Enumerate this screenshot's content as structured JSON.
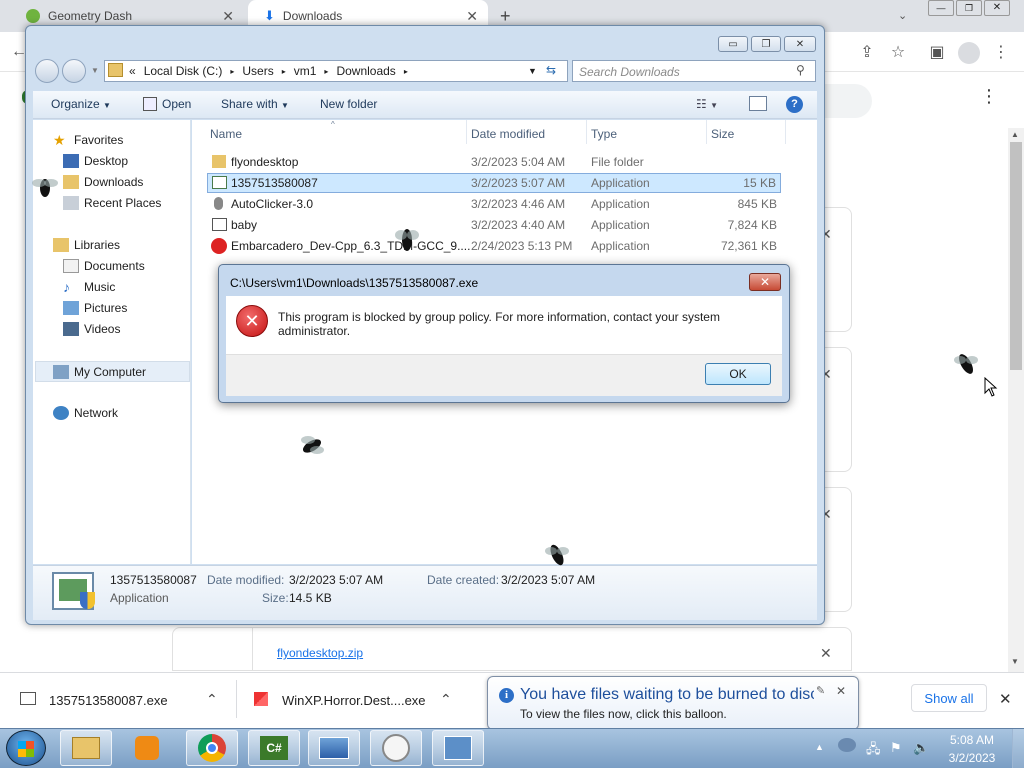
{
  "chrome": {
    "tabs": [
      {
        "label": "Geometry Dash"
      },
      {
        "label": "Downloads"
      }
    ],
    "new_tab": "+",
    "download_card": {
      "filename": "flyondesktop.zip"
    },
    "shelf": {
      "items": [
        {
          "filename": "1357513580087.exe"
        },
        {
          "filename": "WinXP.Horror.Dest....exe"
        }
      ],
      "show_all": "Show all"
    }
  },
  "explorer": {
    "breadcrumb": [
      "Local Disk (C:)",
      "Users",
      "vm1",
      "Downloads"
    ],
    "breadcrumb_prefix": "«",
    "search_placeholder": "Search Downloads",
    "toolbar": {
      "organize": "Organize",
      "open": "Open",
      "share_with": "Share with",
      "new_folder": "New folder"
    },
    "nav": {
      "favorites": "Favorites",
      "favorites_items": [
        "Desktop",
        "Downloads",
        "Recent Places"
      ],
      "libraries": "Libraries",
      "libraries_items": [
        "Documents",
        "Music",
        "Pictures",
        "Videos"
      ],
      "my_computer": "My Computer",
      "network": "Network"
    },
    "columns": [
      "Name",
      "Date modified",
      "Type",
      "Size"
    ],
    "files": [
      {
        "name": "flyondesktop",
        "date": "3/2/2023 5:04 AM",
        "type": "File folder",
        "size": ""
      },
      {
        "name": "1357513580087",
        "date": "3/2/2023 5:07 AM",
        "type": "Application",
        "size": "15 KB"
      },
      {
        "name": "AutoClicker-3.0",
        "date": "3/2/2023 4:46 AM",
        "type": "Application",
        "size": "845 KB"
      },
      {
        "name": "baby",
        "date": "3/2/2023 4:40 AM",
        "type": "Application",
        "size": "7,824 KB"
      },
      {
        "name": "Embarcadero_Dev-Cpp_6.3_TDM-GCC_9....",
        "date": "2/24/2023 5:13 PM",
        "type": "Application",
        "size": "72,361 KB"
      }
    ],
    "details": {
      "name": "1357513580087",
      "kind": "Application",
      "date_modified_label": "Date modified:",
      "date_modified": "3/2/2023 5:07 AM",
      "date_created_label": "Date created:",
      "date_created": "3/2/2023 5:07 AM",
      "size_label": "Size:",
      "size": "14.5 KB"
    }
  },
  "dialog": {
    "title": "C:\\Users\\vm1\\Downloads\\1357513580087.exe",
    "message": "This program is blocked by group policy. For more information, contact your system administrator.",
    "ok": "OK"
  },
  "balloon": {
    "title": "You have files waiting to be burned to disc",
    "text": "To view the files now, click this balloon."
  },
  "taskbar": {
    "time": "5:08 AM",
    "date": "3/2/2023"
  }
}
